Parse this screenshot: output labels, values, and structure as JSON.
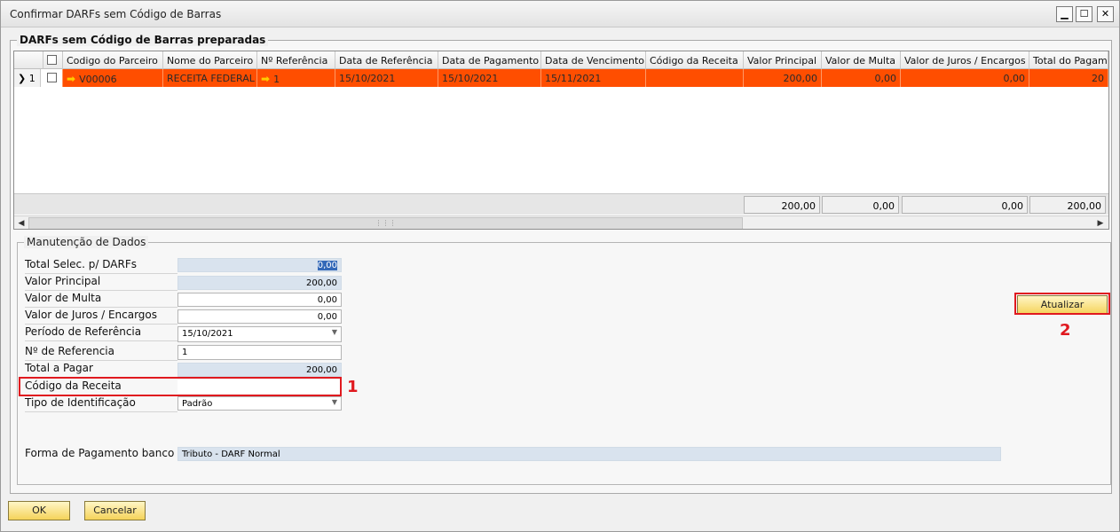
{
  "window": {
    "title": "Confirmar DARFs sem Código de Barras",
    "minimize": "▁",
    "maximize": "☐",
    "close": "✕"
  },
  "grid": {
    "title": "DARFs sem Código de Barras preparadas",
    "columns": [
      "Codigo do Parceiro",
      "Nome do Parceiro",
      "Nº Referência",
      "Data de Referência",
      "Data de Pagamento",
      "Data de Vencimento",
      "Código da Receita",
      "Valor Principal",
      "Valor de Multa",
      "Valor de Juros / Encargos",
      "Total do Pagamen"
    ],
    "rows": [
      {
        "row_number": "1",
        "codigo_parceiro": "V00006",
        "nome_parceiro": "RECEITA FEDERAL",
        "n_referencia": "1",
        "data_referencia": "15/10/2021",
        "data_pagamento": "15/10/2021",
        "data_vencimento": "15/11/2021",
        "codigo_receita": "",
        "valor_principal": "200,00",
        "valor_multa": "0,00",
        "valor_juros": "0,00",
        "total": "20"
      }
    ],
    "totals": {
      "valor_principal": "200,00",
      "valor_multa": "0,00",
      "valor_juros": "0,00",
      "total": "200,00"
    },
    "selected_row_color": "#ff4e00"
  },
  "form": {
    "title": "Manutenção de Dados",
    "total_selec_label": "Total Selec. p/ DARFs",
    "total_selec_value": "0,00",
    "valor_principal_label": "Valor Principal",
    "valor_principal_value": "200,00",
    "valor_multa_label": "Valor de Multa",
    "valor_multa_value": "0,00",
    "valor_juros_label": "Valor de Juros / Encargos",
    "valor_juros_value": "0,00",
    "periodo_label": "Período de Referência",
    "periodo_value": "15/10/2021",
    "n_referencia_label": "Nº de Referencia",
    "n_referencia_value": "1",
    "total_pagar_label": "Total a Pagar",
    "total_pagar_value": "200,00",
    "codigo_receita_label": "Código da Receita",
    "codigo_receita_value": "",
    "tipo_identificacao_label": "Tipo de Identificação",
    "tipo_identificacao_value": "Padrão",
    "forma_pagamento_label": "Forma de Pagamento banco",
    "forma_pagamento_value": "Tributo - DARF Normal"
  },
  "annotations": {
    "marker_1": "1",
    "marker_2": "2",
    "color": "#e0191f"
  },
  "buttons": {
    "atualizar": "Atualizar",
    "ok": "OK",
    "cancelar": "Cancelar"
  }
}
